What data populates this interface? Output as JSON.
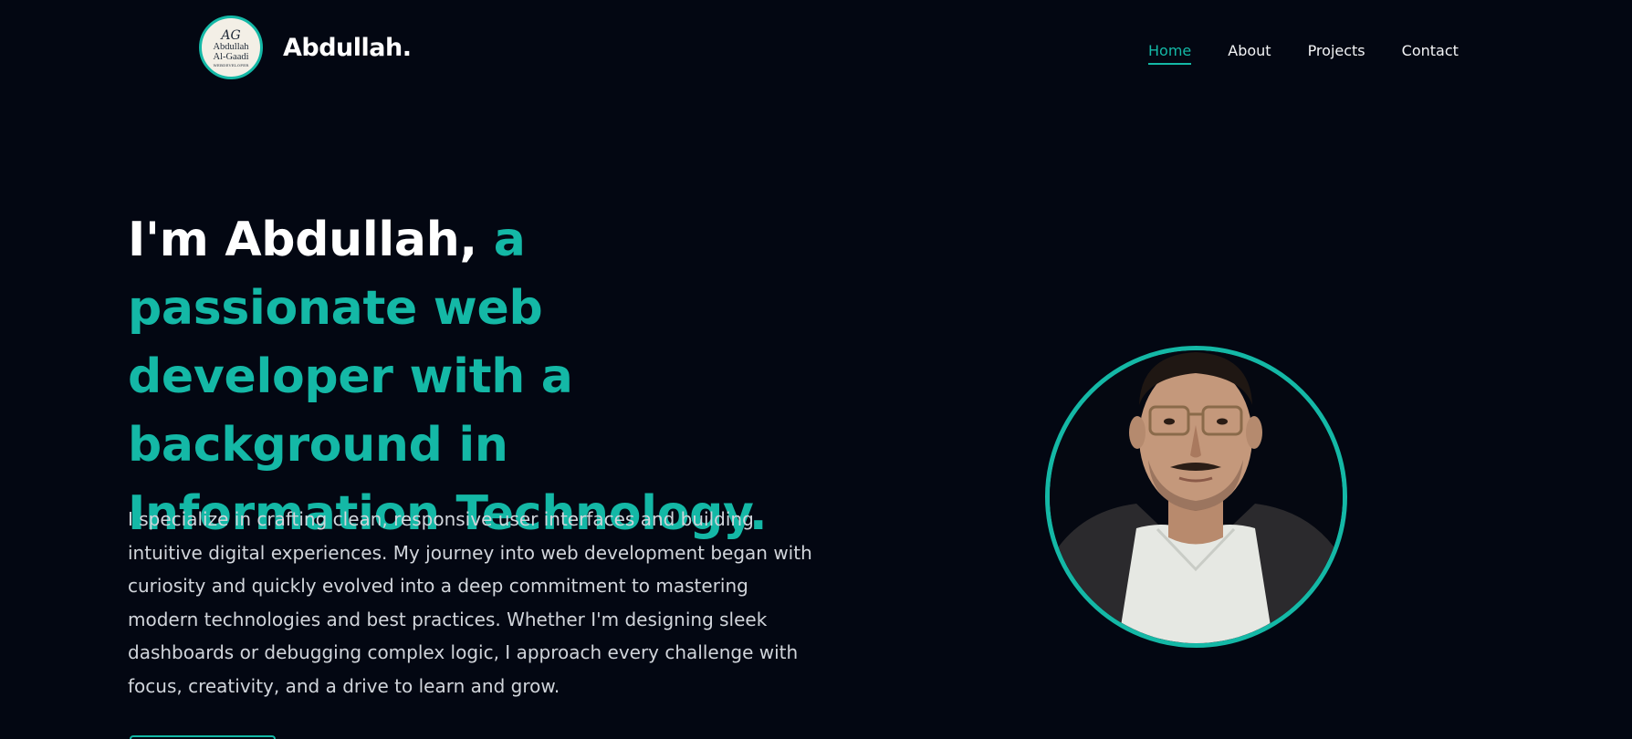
{
  "header": {
    "logo": {
      "mark": "AG",
      "name_line1": "Abdullah",
      "name_line2": "Al-Gaadi",
      "tagline": "WEBDEVELOPER"
    },
    "brand": "Abdullah.",
    "nav": [
      {
        "label": "Home",
        "active": true
      },
      {
        "label": "About",
        "active": false
      },
      {
        "label": "Projects",
        "active": false
      },
      {
        "label": "Contact",
        "active": false
      }
    ]
  },
  "hero": {
    "title_intro": "I'm Abdullah,",
    "title_accent": "a passionate web developer with a background in Information Technology.",
    "description": "I specialize in crafting clean, responsive user interfaces and building intuitive digital experiences. My journey into web development began with curiosity and quickly evolved into a deep commitment to mastering modern technologies and best practices. Whether I'm designing sleek dashboards or debugging complex logic, I approach every challenge with focus, creativity, and a drive to learn and grow."
  },
  "colors": {
    "background": "#030712",
    "accent": "#14b8a6",
    "text": "#ffffff",
    "body_text": "#d1d5db"
  }
}
